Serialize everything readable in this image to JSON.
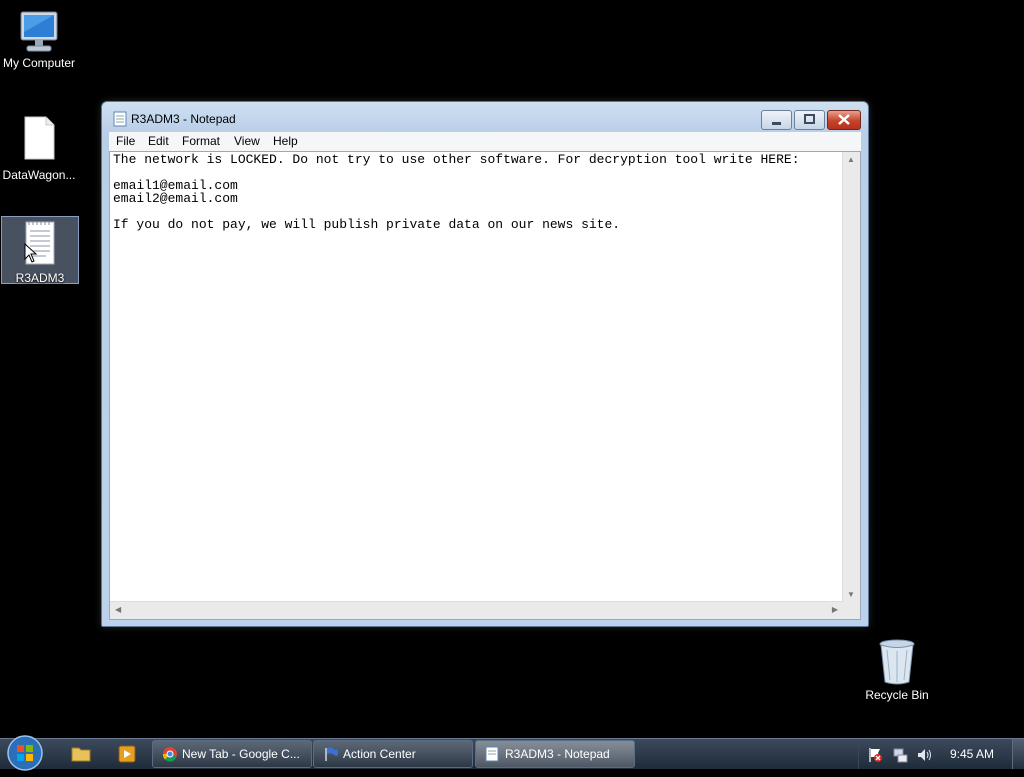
{
  "desktop": {
    "icons": [
      {
        "label": "My Computer"
      },
      {
        "label": "DataWagon..."
      },
      {
        "label": "R3ADM3"
      },
      {
        "label": "Recycle Bin"
      }
    ]
  },
  "window": {
    "title": "R3ADM3 - Notepad",
    "menu": [
      "File",
      "Edit",
      "Format",
      "View",
      "Help"
    ],
    "content": "The network is LOCKED. Do not try to use other software. For decryption tool write HERE:\n\nemail1@email.com\nemail2@email.com\n\nIf you do not pay, we will publish private data on our news site."
  },
  "taskbar": {
    "items": [
      {
        "label": "New Tab - Google C...",
        "icon": "chrome-icon"
      },
      {
        "label": "Action Center",
        "icon": "flag-icon"
      },
      {
        "label": "R3ADM3 - Notepad",
        "icon": "notepad-icon"
      }
    ],
    "clock": "9:45 AM"
  }
}
